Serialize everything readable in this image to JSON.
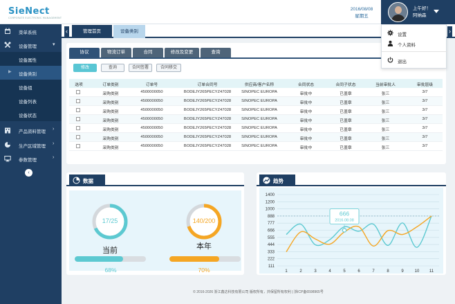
{
  "header": {
    "logo_text": "SieNect",
    "logo_sub": "CORPORATE ELECTRONIC MANAGEMENT",
    "date": "2016/08/08",
    "weekday": "星期五",
    "greeting": "上午好！",
    "username": "阿纳森"
  },
  "user_menu": {
    "items": [
      {
        "label": "设置",
        "icon": "gear-icon"
      },
      {
        "label": "个人资料",
        "icon": "user-icon"
      },
      {
        "label": "退出",
        "icon": "power-icon"
      }
    ]
  },
  "sidebar": {
    "items": [
      {
        "label": "菜单系统",
        "icon": "calendar-icon",
        "arrow": ""
      },
      {
        "label": "设备管理",
        "icon": "tools-icon",
        "arrow": "▾"
      },
      {
        "label": "产品资料管理",
        "icon": "building-icon",
        "arrow": "›"
      },
      {
        "label": "生产区域管理",
        "icon": "pie-icon",
        "arrow": "›"
      },
      {
        "label": "参数管理",
        "icon": "monitor-icon",
        "arrow": "›"
      }
    ],
    "subitems": [
      {
        "label": "设备属性",
        "active": false
      },
      {
        "label": "设备类别",
        "active": true
      },
      {
        "label": "设备组",
        "active": false
      },
      {
        "label": "设备列表",
        "active": false
      },
      {
        "label": "设备状态",
        "active": false
      }
    ],
    "toggle": "‹"
  },
  "tabs": {
    "items": [
      {
        "label": "管理首页",
        "active": true
      },
      {
        "label": "设备类别",
        "active": false
      }
    ]
  },
  "panel": {
    "subtabs": [
      "协议",
      "物流订单",
      "合同",
      "修改及变更",
      "查询"
    ],
    "buttons": [
      "修改",
      "查询",
      "合同签署",
      "合同移交"
    ],
    "columns": [
      "选项",
      "订单类别",
      "订单号",
      "订单合同号",
      "供应商/客户名称",
      "合同状态",
      "合同子状态",
      "当前审批人",
      "审批层级"
    ],
    "rows": [
      [
        "采购类别",
        "4500000050",
        "BODEJY265PECYZ47028",
        "SINOPEC EUROPA",
        "审批中",
        "已盖章",
        "张三",
        "3/7"
      ],
      [
        "采购类别",
        "4500000050",
        "BODEJY265PECYZ47028",
        "SINOPEC EUROPA",
        "审批中",
        "已盖章",
        "张三",
        "3/7"
      ],
      [
        "采购类别",
        "4500000050",
        "BODEJY265PECYZ47028",
        "SINOPEC EUROPA",
        "审批中",
        "已盖章",
        "张三",
        "3/7"
      ],
      [
        "采购类别",
        "4500000050",
        "BODEJY265PECYZ47028",
        "SINOPEC EUROPA",
        "审批中",
        "已盖章",
        "张三",
        "3/7"
      ],
      [
        "采购类别",
        "4500000050",
        "BODEJY265PECYZ47028",
        "SINOPEC EUROPA",
        "审批中",
        "已盖章",
        "张三",
        "3/7"
      ],
      [
        "采购类别",
        "4500000050",
        "BODEJY265PECYZ47028",
        "SINOPEC EUROPA",
        "审批中",
        "已盖章",
        "张三",
        "3/7"
      ],
      [
        "采购类别",
        "4500000050",
        "BODEJY265PECYZ47028",
        "SINOPEC EUROPA",
        "审批中",
        "已盖章",
        "张三",
        "3/7"
      ]
    ]
  },
  "data_card": {
    "title": "数据",
    "current": {
      "ring_text": "17/25",
      "label": "当前",
      "percent_text": "68%",
      "fraction": 0.68,
      "color": "#5cc9d1"
    },
    "year": {
      "ring_text": "140/200",
      "label": "本年",
      "percent_text": "70%",
      "fraction": 0.7,
      "color": "#f5a623"
    }
  },
  "trend_card": {
    "title": "趋势",
    "tooltip_value": "666",
    "tooltip_date": "2016.08.08"
  },
  "chart_data": {
    "type": "line",
    "x": [
      1,
      2,
      3,
      4,
      5,
      6,
      7,
      8,
      9,
      10,
      11
    ],
    "yticks": [
      111,
      222,
      333,
      444,
      555,
      666,
      777,
      888,
      1000,
      1200,
      1400
    ],
    "ylabels": [
      "1400",
      "1200",
      "1000",
      "888",
      "777",
      "666",
      "555",
      "444",
      "333",
      "222",
      "111"
    ],
    "ylim": [
      111,
      1400
    ],
    "reference_value": 888,
    "series": [
      {
        "color": "#5cc9d1",
        "values": [
          600,
          760,
          440,
          520,
          720,
          650,
          760,
          430,
          780,
          400,
          888
        ]
      },
      {
        "color": "#f5a623",
        "values": [
          330,
          640,
          530,
          450,
          640,
          720,
          420,
          660,
          600,
          720,
          888
        ]
      }
    ],
    "highlight": {
      "x": 5,
      "value": 666
    }
  },
  "footer": {
    "text": "© 2016-2026 浙江鑫达科技有限公司 版权所有，并保留所有权利 | 浙ICP备6598965号"
  }
}
